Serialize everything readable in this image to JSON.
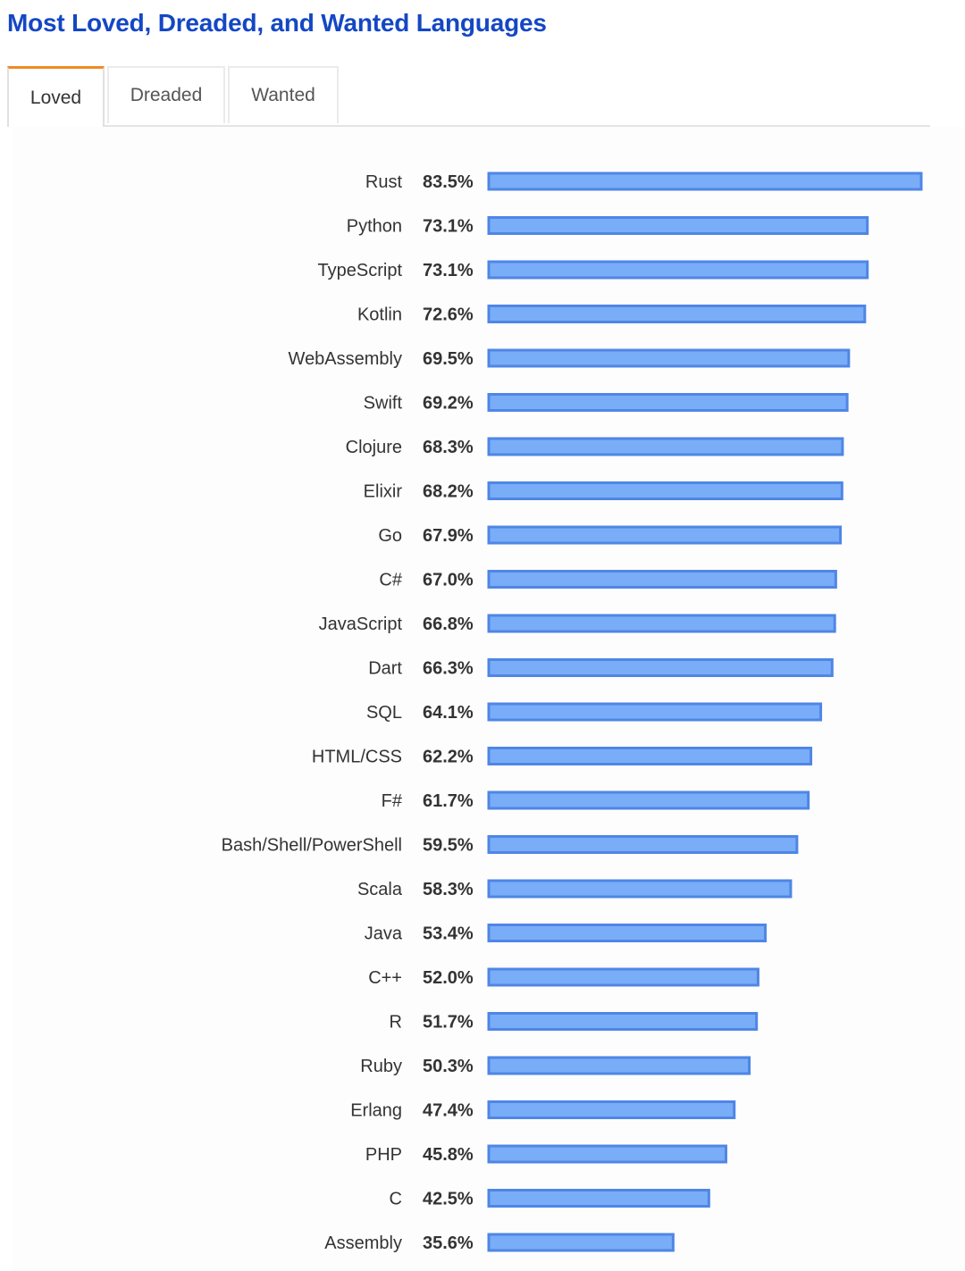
{
  "page": {
    "title": "Most Loved, Dreaded, and Wanted Languages"
  },
  "tabs": [
    {
      "label": "Loved",
      "active": true
    },
    {
      "label": "Dreaded",
      "active": false
    },
    {
      "label": "Wanted",
      "active": false
    }
  ],
  "colors": {
    "title": "#1447c4",
    "active_tab_accent": "#f08a24",
    "bar_fill": "#7aadf7",
    "bar_stroke": "#4f86e6"
  },
  "chart_data": {
    "type": "bar",
    "orientation": "horizontal",
    "title": "Most Loved, Dreaded, and Wanted Languages",
    "subtitle": "Loved",
    "xlabel": "",
    "ylabel": "",
    "xlim": [
      0,
      83.5
    ],
    "grid": false,
    "legend": "none",
    "value_suffix": "%",
    "categories": [
      "Rust",
      "Python",
      "TypeScript",
      "Kotlin",
      "WebAssembly",
      "Swift",
      "Clojure",
      "Elixir",
      "Go",
      "C#",
      "JavaScript",
      "Dart",
      "SQL",
      "HTML/CSS",
      "F#",
      "Bash/Shell/PowerShell",
      "Scala",
      "Java",
      "C++",
      "R",
      "Ruby",
      "Erlang",
      "PHP",
      "C",
      "Assembly"
    ],
    "values": [
      83.5,
      73.1,
      73.1,
      72.6,
      69.5,
      69.2,
      68.3,
      68.2,
      67.9,
      67.0,
      66.8,
      66.3,
      64.1,
      62.2,
      61.7,
      59.5,
      58.3,
      53.4,
      52.0,
      51.7,
      50.3,
      47.4,
      45.8,
      42.5,
      35.6
    ],
    "value_labels": [
      "83.5%",
      "73.1%",
      "73.1%",
      "72.6%",
      "69.5%",
      "69.2%",
      "68.3%",
      "68.2%",
      "67.9%",
      "67.0%",
      "66.8%",
      "66.3%",
      "64.1%",
      "62.2%",
      "61.7%",
      "59.5%",
      "58.3%",
      "53.4%",
      "52.0%",
      "51.7%",
      "50.3%",
      "47.4%",
      "45.8%",
      "42.5%",
      "35.6%"
    ]
  }
}
